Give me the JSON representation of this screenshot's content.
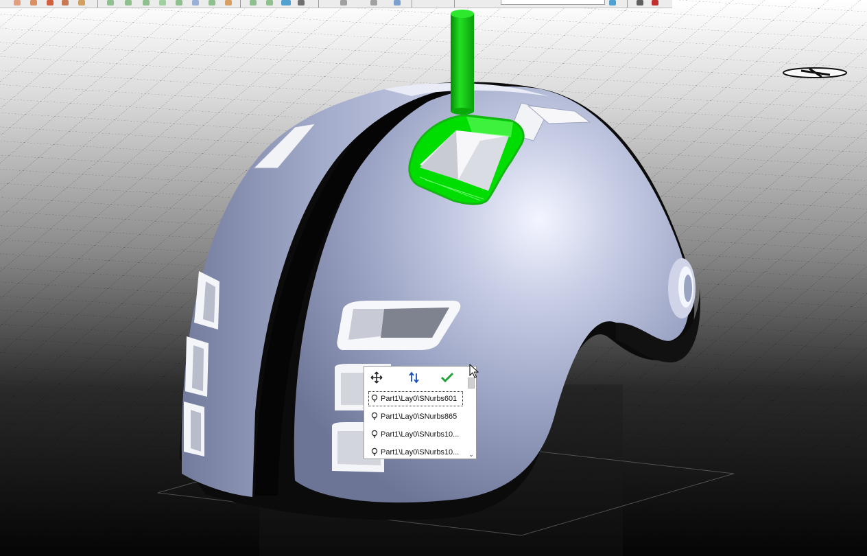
{
  "toolbar": {
    "visible": "partial"
  },
  "scene": {
    "model": "helmet",
    "highlight_color": "#00dd00",
    "shell_color": "#9aa3c4"
  },
  "selection_popup": {
    "tools": [
      {
        "icon": "move-arrows-icon"
      },
      {
        "icon": "swap-arrows-icon"
      },
      {
        "icon": "checkmark-icon"
      }
    ],
    "items": [
      {
        "label": "Part1\\Lay0\\SNurbs601",
        "selected": true
      },
      {
        "label": "Part1\\Lay0\\SNurbs865",
        "selected": false
      },
      {
        "label": "Part1\\Lay0\\SNurbs10...",
        "selected": false
      },
      {
        "label": "Part1\\Lay0\\SNurbs10...",
        "selected": false
      }
    ]
  }
}
